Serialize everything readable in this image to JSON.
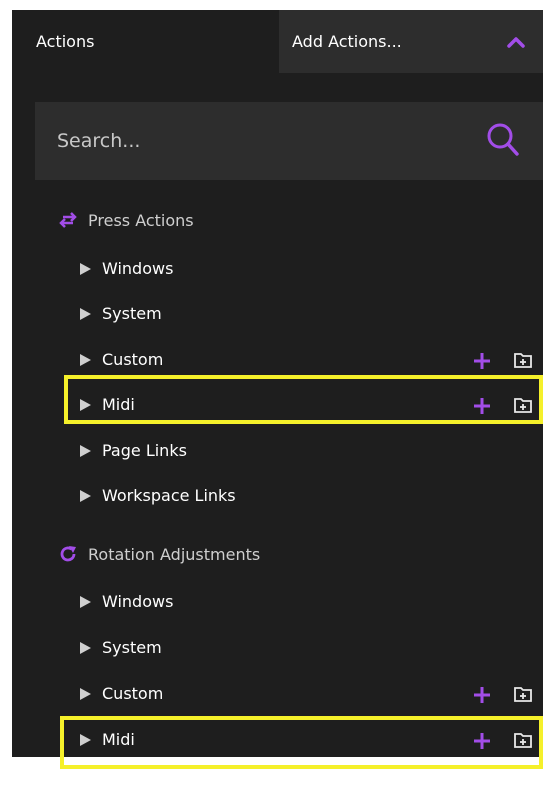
{
  "header": {
    "title": "Actions",
    "add_actions_label": "Add Actions..."
  },
  "search": {
    "placeholder": "Search..."
  },
  "sections": [
    {
      "title": "Press Actions",
      "icon": "swap-arrows-icon",
      "items": [
        {
          "label": "Windows"
        },
        {
          "label": "System"
        },
        {
          "label": "Custom"
        },
        {
          "label": "Midi"
        },
        {
          "label": "Page Links"
        },
        {
          "label": "Workspace Links"
        }
      ]
    },
    {
      "title": "Rotation Adjustments",
      "icon": "rotate-icon",
      "items": [
        {
          "label": "Windows"
        },
        {
          "label": "System"
        },
        {
          "label": "Custom"
        },
        {
          "label": "Midi"
        }
      ]
    }
  ],
  "colors": {
    "accent": "#a24de8",
    "highlight": "#f5f02a",
    "panel": "#1e1e1e"
  }
}
